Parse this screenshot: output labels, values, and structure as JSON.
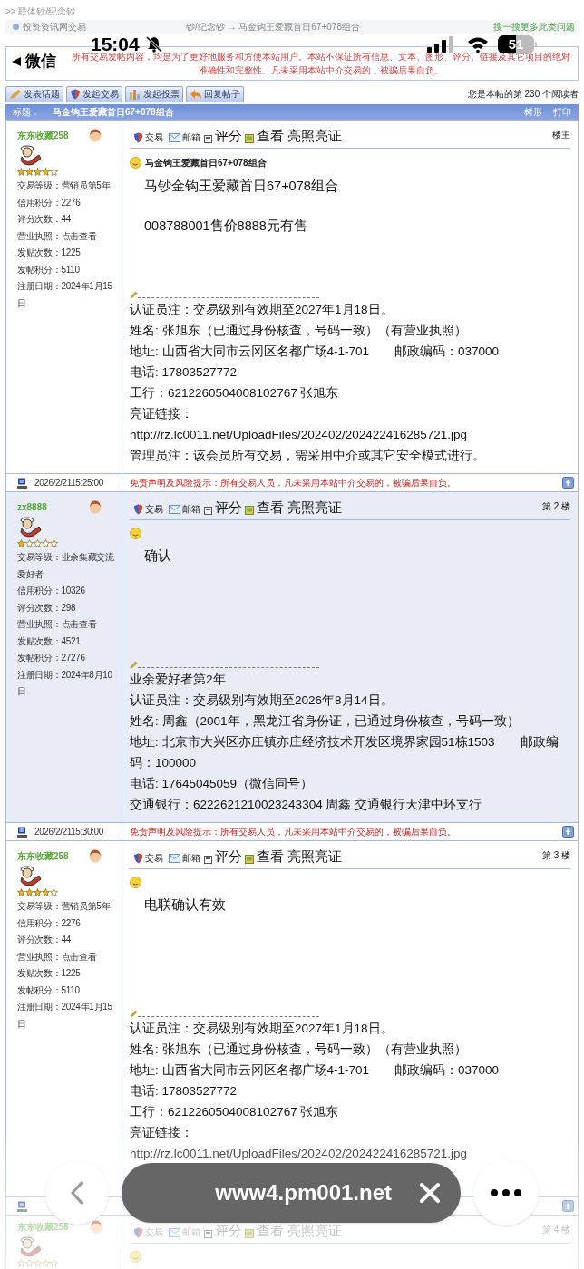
{
  "status_bar": {
    "time": "15:04",
    "back_label": "微信",
    "battery": "51"
  },
  "top_path": ">> 联体钞/纪念钞",
  "breadcrumb": {
    "start": "投资资讯网交易",
    "end": "钞/纪念钞 → 马金钩王爱藏首日67+078组合",
    "link": "搜一搜更多此类问题"
  },
  "disclaimer": "所有交易发帖内容，均是为了更好地服务和方便本站用户。本站不保证所有信息、文本、图形、评分、链接及其它项目的绝对准确性和完整性。凡未采用本站中介交易的，被骗后果自负。",
  "toolbar": [
    {
      "label": "发表话题"
    },
    {
      "label": "发起交易"
    },
    {
      "label": "发起投票"
    },
    {
      "label": "回复帖子"
    }
  ],
  "reader_count": "您是本帖的第 230 个阅读者",
  "title_bar": {
    "label": "标题：",
    "title": "马金钩王爱藏首日67+078组合",
    "links": [
      "树形",
      "打印"
    ]
  },
  "posts": [
    {
      "user": {
        "name": "东东收藏258",
        "stars": 4,
        "fields": [
          {
            "label": "交易等级：",
            "value": "营销员第5年"
          },
          {
            "label": "信用积分：",
            "value": "2276"
          },
          {
            "label": "评分次数：",
            "value": "44"
          },
          {
            "label": "营业执照：",
            "value": "点击查看"
          },
          {
            "label": "发贴次数：",
            "value": "1225"
          },
          {
            "label": "发帖积分：",
            "value": "5110"
          },
          {
            "label": "注册日期：",
            "value": "2024年1月15日"
          }
        ]
      },
      "actions": {
        "trade": "交易",
        "mail": "邮箱",
        "rate": "评分",
        "view": "查看",
        "license": "亮照亮证"
      },
      "floor": "楼主",
      "subject": "马金钩王爱藏首日67+078组合",
      "body": [
        "马钞金钩王爱藏首日67+078组合",
        "008788001售价8888元有售"
      ],
      "signature": [
        "认证员注：交易级别有效期至2027年1月18日。",
        "姓名: 张旭东（已通过身份核查，号码一致）（有营业执照）",
        "地址: 山西省大同市云冈区名都广场4-1-701　　邮政编码：037000",
        "电话: 17803527772",
        "工行：6212260504008102767 张旭东",
        "亮证链接：",
        "http://rz.lc0011.net/UploadFiles/202402/202422416285721.jpg",
        "管理员注：该会员所有交易，需采用中介或其它安全模式进行。"
      ],
      "footer": {
        "time": "2026/2/2115:25:00",
        "notice": "免责声明及风险提示：所有交易人员，凡未采用本站中介交易的，被骗后果自负。"
      }
    },
    {
      "user": {
        "name": "zx8888",
        "stars": 1,
        "fields": [
          {
            "label": "交易等级：",
            "value": "业余集藏交流爱好者"
          },
          {
            "label": "信用积分：",
            "value": "10326"
          },
          {
            "label": "评分次数：",
            "value": "298"
          },
          {
            "label": "营业执照：",
            "value": "点击查看"
          },
          {
            "label": "发贴次数：",
            "value": "4521"
          },
          {
            "label": "发帖积分：",
            "value": "27276"
          },
          {
            "label": "注册日期：",
            "value": "2024年8月10日"
          }
        ]
      },
      "actions": {
        "trade": "交易",
        "mail": "邮箱",
        "rate": "评分",
        "view": "查看",
        "license": "亮照亮证"
      },
      "floor": "第 2 楼",
      "body": [
        "确认"
      ],
      "signature": [
        "业余爱好者第2年",
        "认证员注：交易级别有效期至2026年8月14日。",
        "姓名: 周鑫（2001年，黑龙江省身份证，已通过身份核查，号码一致）",
        "地址: 北京市大兴区亦庄镇亦庄经济技术开发区境界家园51栋1503　　邮政编码：100000",
        "电话: 17645045059（微信同号）",
        "交通银行：6222621210023243304 周鑫 交通银行天津中环支行"
      ],
      "footer": {
        "time": "2026/2/2115:30:00",
        "notice": "免责声明及风险提示：所有交易人员，凡未采用本站中介交易的，被骗后果自负。"
      }
    },
    {
      "user": {
        "name": "东东收藏258",
        "stars": 4,
        "fields": [
          {
            "label": "交易等级：",
            "value": "营销员第5年"
          },
          {
            "label": "信用积分：",
            "value": "2276"
          },
          {
            "label": "评分次数：",
            "value": "44"
          },
          {
            "label": "营业执照：",
            "value": "点击查看"
          },
          {
            "label": "发贴次数：",
            "value": "1225"
          },
          {
            "label": "发帖积分：",
            "value": "5110"
          },
          {
            "label": "注册日期：",
            "value": "2024年1月15日"
          }
        ]
      },
      "actions": {
        "trade": "交易",
        "mail": "邮箱",
        "rate": "评分",
        "view": "查看",
        "license": "亮照亮证"
      },
      "floor": "第 3 楼",
      "body": [
        "电联确认有效"
      ],
      "signature": [
        "认证员注：交易级别有效期至2027年1月18日。",
        "姓名: 张旭东（已通过身份核查，号码一致）（有营业执照）",
        "地址: 山西省大同市云冈区名都广场4-1-701　　邮政编码：037000",
        "电话: 17803527772",
        "工行：6212260504008102767 张旭东",
        "亮证链接：",
        "http://rz.lc0011.net/UploadFiles/202402/202422416285721.jpg"
      ]
    }
  ],
  "next_post": {
    "name": "东东收藏258",
    "stars": 0,
    "floor": "第 4 楼",
    "actions": {
      "trade": "交易",
      "mail": "邮箱",
      "rate": "评分",
      "view": "查看",
      "license": "亮照亮证"
    }
  },
  "browser_bar": {
    "url": "www4.pm001.net"
  }
}
